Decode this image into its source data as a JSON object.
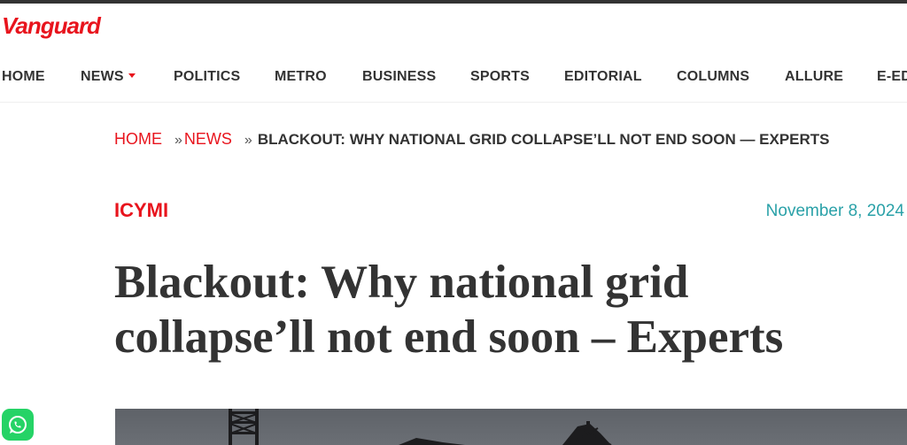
{
  "site": {
    "logo": "Vanguard"
  },
  "nav": {
    "items": [
      "HOME",
      "NEWS",
      "POLITICS",
      "METRO",
      "BUSINESS",
      "SPORTS",
      "EDITORIAL",
      "COLUMNS",
      "ALLURE",
      "E-ED"
    ]
  },
  "breadcrumb": {
    "home": "HOME",
    "sep1": "»",
    "news": "NEWS",
    "sep2": "»",
    "current": "BLACKOUT: WHY NATIONAL GRID COLLAPSE’LL NOT END SOON — EXPERTS"
  },
  "article": {
    "category": "ICYMI",
    "date": "November 8, 2024",
    "title": "Blackout: Why national grid collapse’ll not end soon – Experts"
  },
  "icons": {
    "share": "whatsapp-icon",
    "news_dropdown": "caret-down-icon"
  },
  "colors": {
    "brand": "#e8141d",
    "date": "#2aa1a8",
    "text": "#333333"
  }
}
